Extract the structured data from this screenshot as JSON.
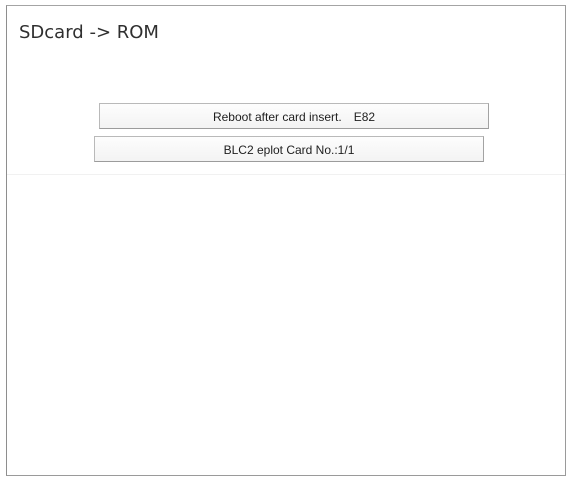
{
  "screen": {
    "title": "SDcard -> ROM"
  },
  "messages": [
    {
      "text": "Reboot after card insert.",
      "code": "E82"
    },
    {
      "text": "BLC2 eplot Card No.:1/1"
    }
  ]
}
